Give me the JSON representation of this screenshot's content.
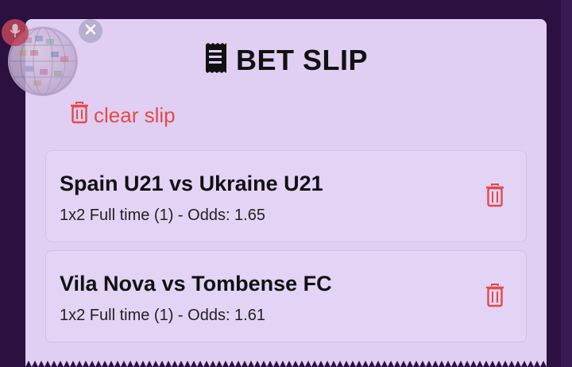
{
  "slip": {
    "title": "BET SLIP",
    "clear_label": "clear slip"
  },
  "bets": [
    {
      "match": "Spain U21 vs Ukraine U21",
      "detail": "1x2 Full time (1) - Odds: 1.65"
    },
    {
      "match": "Vila Nova vs Tombense FC",
      "detail": "1x2 Full time (1) - Odds: 1.61"
    }
  ],
  "icons": {
    "title": "receipt-icon",
    "clear": "trash-icon",
    "remove": "trash-icon",
    "overlay_close": "close-icon",
    "overlay_mic": "microphone-icon"
  },
  "colors": {
    "background": "#2a1140",
    "panel": "#e0cff2",
    "danger": "#e34a4a",
    "text": "#111111"
  }
}
